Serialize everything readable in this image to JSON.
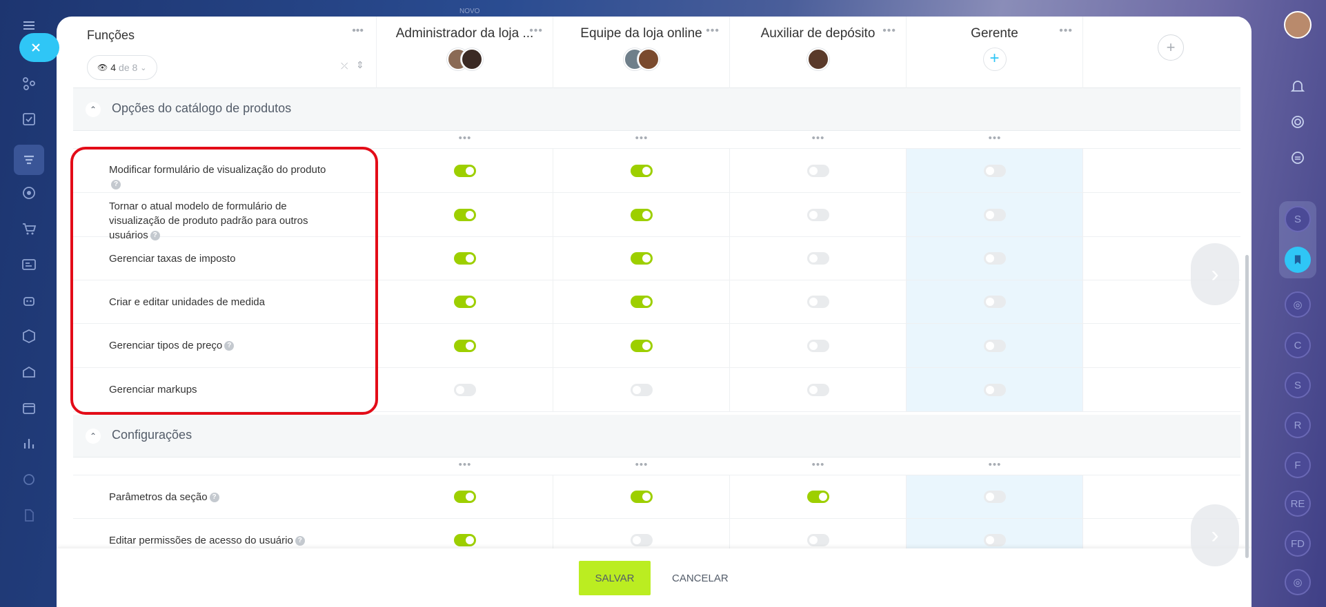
{
  "top_hint": "NOVO",
  "grid": {
    "first_column": {
      "title": "Funções",
      "view_count": "4",
      "view_of": "de 8"
    },
    "roles": [
      {
        "name": "Administrador da loja ...",
        "avatars": 2,
        "colors": [
          "#8a6a55",
          "#3b2a24"
        ]
      },
      {
        "name": "Equipe da loja online",
        "avatars": 2,
        "colors": [
          "#6f7f8a",
          "#7a4a2e"
        ]
      },
      {
        "name": "Auxiliar de depósito",
        "avatars": 1,
        "colors": [
          "#5a3a2a"
        ]
      },
      {
        "name": "Gerente",
        "avatars": 0,
        "colors": []
      }
    ],
    "add_role_icon": "plus-icon"
  },
  "sections": [
    {
      "title": "Opções do catálogo de produtos",
      "rows": [
        {
          "label": "Modificar formulário de visualização do produto",
          "help": true,
          "values": [
            true,
            true,
            false,
            false
          ]
        },
        {
          "label": "Tornar o atual modelo de formulário de visualização de produto padrão para outros usuários",
          "help": true,
          "values": [
            true,
            true,
            false,
            false
          ]
        },
        {
          "label": "Gerenciar taxas de imposto",
          "help": false,
          "values": [
            true,
            true,
            false,
            false
          ]
        },
        {
          "label": "Criar e editar unidades de medida",
          "help": false,
          "values": [
            true,
            true,
            false,
            false
          ]
        },
        {
          "label": "Gerenciar tipos de preço",
          "help": true,
          "values": [
            true,
            true,
            false,
            false
          ]
        },
        {
          "label": "Gerenciar markups",
          "help": false,
          "values": [
            false,
            false,
            false,
            false
          ]
        }
      ]
    },
    {
      "title": "Configurações",
      "rows": [
        {
          "label": "Parâmetros da seção",
          "help": true,
          "values": [
            true,
            true,
            true,
            false
          ]
        },
        {
          "label": "Editar permissões de acesso do usuário",
          "help": true,
          "values": [
            true,
            false,
            false,
            false
          ]
        }
      ]
    }
  ],
  "footer": {
    "save_label": "SALVAR",
    "cancel_label": "CANCELAR"
  },
  "right_sidebar_badges": [
    "S",
    "C",
    "S",
    "R",
    "F",
    "RE",
    "FD"
  ],
  "colors": {
    "toggle_on": "#9dcf00",
    "toggle_off": "#e9ebed",
    "save_button": "#bbed21",
    "highlight_border": "#e30c18",
    "highlight_column": "#eaf6fd",
    "accent_blue": "#2fc6f6"
  }
}
